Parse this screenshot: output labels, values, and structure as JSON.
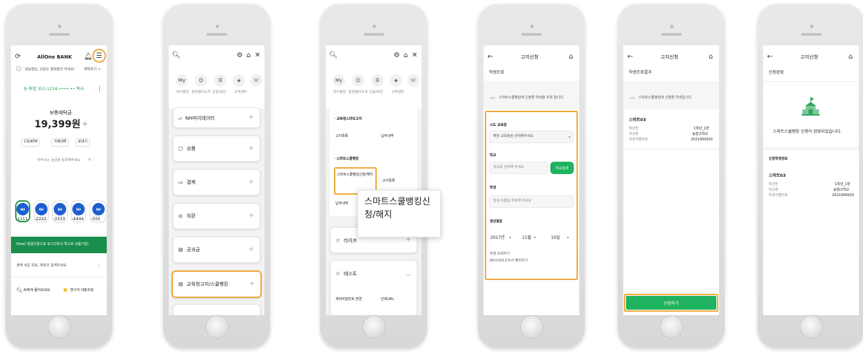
{
  "colors": {
    "accent_orange": "#f0a93a",
    "nh_green": "#1fb35f",
    "banner_green": "#1a8e4c",
    "nh_blue": "#1d5fd1"
  },
  "screen1": {
    "brand": "AllOne BANK",
    "greeting": "김농협님, 오늘도 행복충전 하세요!",
    "greeting_link": "혜택보기 >",
    "account_line": "농·축협 351-1234-••••-•• 복사",
    "account_type": "보통예탁금",
    "balance": "19,399원",
    "buttons": [
      "CD/ATM",
      "거래내역",
      "보내기"
    ],
    "hint": "자주쓰는 송금을 등록해주세요",
    "accounts": [
      "-1111",
      "-2222",
      "-3333",
      "-4444",
      "-555"
    ],
    "banner": "(New) 얼굴인증으로 로그인하고 특으로 상품가입!",
    "goal": "올해 세운 목표, 예정과 함께하세요.",
    "search": "AI에게 물어보세요",
    "loan": "방구석 대출조회"
  },
  "screen2": {
    "shortcuts": [
      "My",
      "마이올원",
      "올원뱅크소개",
      "인증/보안",
      "고객센터"
    ],
    "menu": [
      "NH마이데이터",
      "상품",
      "결제",
      "외환",
      "공과금",
      "교육청고지/스쿨뱅킹"
    ]
  },
  "screen3": {
    "shortcuts": [
      "My",
      "마이올원",
      "올원뱅크소개",
      "인증/보안",
      "고객센터"
    ],
    "section1_title": "· 교육청스마트고지",
    "section1_items": [
      "고지목록",
      "납부내역"
    ],
    "section2_title": "· 스마트스쿨뱅킹",
    "section2_items": [
      "스마트스쿨뱅킹신청/해지",
      "고지목록",
      "납부내역"
    ],
    "tooltip": "스마트스쿨뱅킹신청/해지",
    "life": "라이프",
    "test": "테스트",
    "test_items": [
      "계좌비밀번호 변경",
      "단축URL"
    ]
  },
  "screen4": {
    "title": "고지신청",
    "subtitle": "학생조회",
    "notice": "스마트스쿨뱅킹에 신청할 학생을 조회 합니다.",
    "edu_label": "시도 교육청",
    "edu_placeholder": "해당 교육청을 선택해주세요",
    "school_label": "학교",
    "school_placeholder": "학교를 검색해 주세요",
    "school_button": "학교검색",
    "student_label": "학생",
    "student_placeholder": "학생 이름을 조회해 주세요",
    "birth_label": "생년월일",
    "year": "2017년",
    "month": "11월",
    "day": "10일",
    "foot1": "학생 조회하기",
    "foot2": "NH스마트고지서 해지하기"
  },
  "screen5": {
    "title": "고지신청",
    "subtitle": "학생조회결과",
    "notice": "스마트스쿨뱅킹에 신청할 학생입니다.",
    "name": "스마트03",
    "rows": [
      [
        "학년반",
        "1학년_1반"
      ],
      [
        "학교명",
        "농협고학교"
      ],
      [
        "학생식별번호",
        "2021000003"
      ]
    ],
    "apply": "신청하기"
  },
  "screen6": {
    "title": "고지신청",
    "subtitle": "신청완료",
    "done": "스마트스쿨뱅킹 신청이 완료되었습니다.",
    "info_title": "신청학생정보",
    "name": "스마트03",
    "rows": [
      [
        "학년반",
        "1학년_1반"
      ],
      [
        "학교명",
        "농협고학교"
      ],
      [
        "학생식별번호",
        "2021000003"
      ]
    ]
  }
}
